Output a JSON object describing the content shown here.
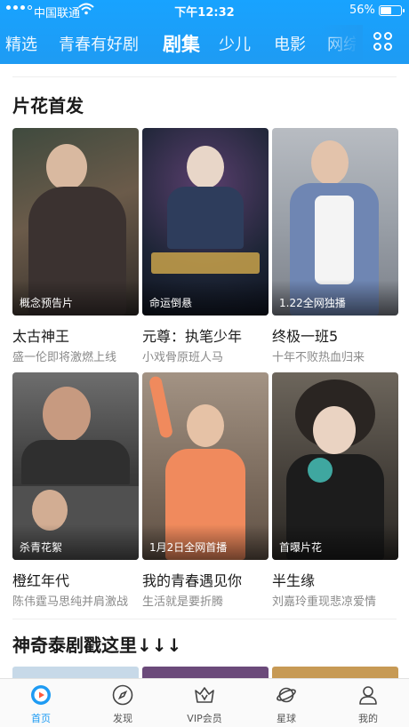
{
  "status_bar": {
    "carrier": "中国联通",
    "time": "下午12:32",
    "battery_pct": "56%",
    "battery_level": 0.56,
    "icons": [
      "signal-dots-icon",
      "wifi-icon",
      "battery-icon"
    ]
  },
  "tabs": [
    {
      "label": "精选",
      "active": false
    },
    {
      "label": "青春有好剧",
      "active": false
    },
    {
      "label": "剧集",
      "active": true
    },
    {
      "label": "少儿",
      "active": false
    },
    {
      "label": "电影",
      "active": false
    },
    {
      "label": "网综",
      "active": false
    }
  ],
  "header_icons": {
    "channel_grid": "channel-grid-icon"
  },
  "sections": [
    {
      "title": "片花首发",
      "cards": [
        {
          "title": "太古神王",
          "subtitle": "盛一伦即将激燃上线",
          "badge": "概念预告片",
          "poster_color": "#5d5048"
        },
        {
          "title": "元尊：执笔少年",
          "subtitle": "小戏骨原班人马",
          "badge": "命运倒悬",
          "poster_color": "#1d2536"
        },
        {
          "title": "终极一班5",
          "subtitle": "十年不败热血归来",
          "badge": "1.22全网独播",
          "poster_color": "#8d94a0"
        },
        {
          "title": "橙红年代",
          "subtitle": "陈伟霆马思纯并肩激战",
          "badge": "杀青花絮",
          "poster_color": "#4a4a4a"
        },
        {
          "title": "我的青春遇见你",
          "subtitle": "生活就是要折腾",
          "badge": "1月2日全网首播",
          "poster_color": "#8c7a6b"
        },
        {
          "title": "半生缘",
          "subtitle": "刘嘉玲重现悲凉爱情",
          "badge": "首曝片花",
          "poster_color": "#3a3733"
        }
      ]
    },
    {
      "title": "神奇泰剧戳这里↓↓↓"
    }
  ],
  "bottom_nav": [
    {
      "label": "首页",
      "icon": "home-play-icon",
      "active": true
    },
    {
      "label": "发现",
      "icon": "compass-icon",
      "active": false
    },
    {
      "label": "VIP会员",
      "icon": "crown-vip-icon",
      "active": false
    },
    {
      "label": "星球",
      "icon": "planet-icon",
      "active": false
    },
    {
      "label": "我的",
      "icon": "profile-icon",
      "active": false
    }
  ]
}
